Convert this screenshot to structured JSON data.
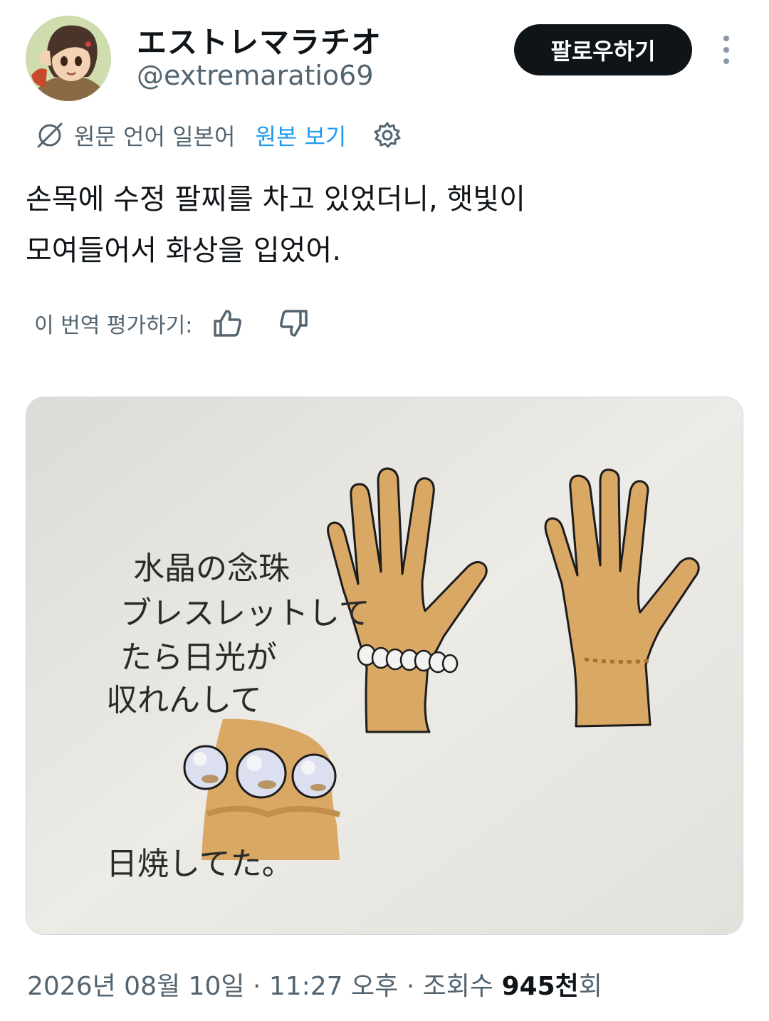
{
  "author": {
    "display_name": "エストレマラチオ",
    "handle": "@extremaratio69",
    "avatar": "anime-character-avatar"
  },
  "follow_button": "팔로우하기",
  "translation": {
    "original_language": "원문 언어 일본어",
    "show_original": "원본 보기",
    "rate_label": "이 번역 평가하기:"
  },
  "tweet": {
    "line1": "손목에 수정 팔찌를 차고 있었더니, 햇빛이",
    "line2": "모여들어서 화상을 입었어."
  },
  "image_text": {
    "line1": "水晶の念珠",
    "line2": "ブレスレットして",
    "line3": "たら日光が",
    "line4": "収れんして",
    "line5": "日焼してた。"
  },
  "meta": {
    "date": "2026년 08월 10일",
    "time": "11:27 오후",
    "views_label": "조회수",
    "views_count": "945천",
    "views_suffix": "회"
  },
  "icons": {
    "translate": "translate-globe-icon",
    "settings": "gear-icon",
    "like": "thumbs-up-icon",
    "dislike": "thumbs-down-icon",
    "more": "more-vertical-icon"
  },
  "colors": {
    "accent": "#1d9bf0",
    "text": "#0f1419",
    "muted": "#536471",
    "skin": "#d9a865",
    "paper": "#e9e8e2"
  }
}
